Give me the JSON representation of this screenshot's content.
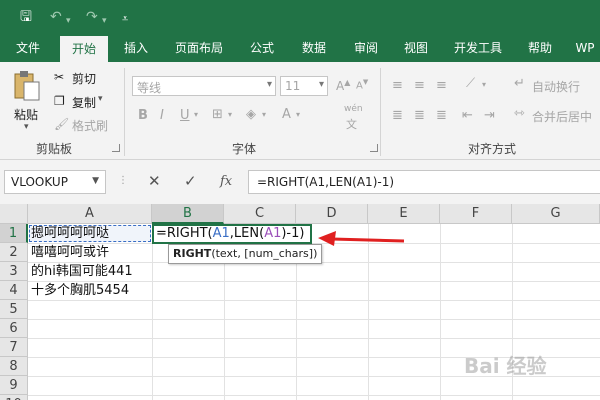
{
  "quick_access": {
    "save_icon": "save-icon",
    "undo_icon": "undo-icon",
    "redo_icon": "redo-icon",
    "customize_icon": "customize-icon"
  },
  "tabs": [
    "文件",
    "开始",
    "插入",
    "页面布局",
    "公式",
    "数据",
    "审阅",
    "视图",
    "开发工具",
    "帮助",
    "WP"
  ],
  "active_tab": "开始",
  "clipboard": {
    "paste": "粘贴",
    "cut": "剪切",
    "copy": "复制",
    "format_painter": "格式刷",
    "label": "剪贴板"
  },
  "font": {
    "name_placeholder": "等线",
    "size": "11",
    "bold": "B",
    "italic": "I",
    "underline": "U",
    "wen": "wén",
    "label": "字体"
  },
  "alignment": {
    "wrap_text": "自动换行",
    "merge_center": "合并后居中",
    "label": "对齐方式"
  },
  "formula_bar": {
    "name_box": "VLOOKUP",
    "cancel": "✕",
    "enter": "✓",
    "fx": "fx",
    "formula": "=RIGHT(A1,LEN(A1)-1)"
  },
  "columns": [
    "A",
    "B",
    "C",
    "D",
    "E",
    "F",
    "G"
  ],
  "rows": [
    "1",
    "2",
    "3",
    "4",
    "5",
    "6",
    "7",
    "8",
    "9",
    "10"
  ],
  "cells": {
    "A1": "摁呵呵呵呵哒",
    "A2": "嘻嘻呵呵或许",
    "A3": "的hi韩国可能441",
    "A4": "十多个胸肌5454"
  },
  "edit_cell": {
    "p1": "=RIGHT(",
    "r1": "A1",
    "p2": ",LEN(",
    "r2": "A1",
    "p3": ")-1)"
  },
  "tooltip": {
    "fn": "RIGHT",
    "args": "(text, [num_chars])"
  },
  "watermark": "Bai 经验",
  "colors": {
    "brand": "#217346",
    "arrow": "#e02020",
    "ref1": "#3a6ec5",
    "ref2": "#9b4fb9"
  }
}
